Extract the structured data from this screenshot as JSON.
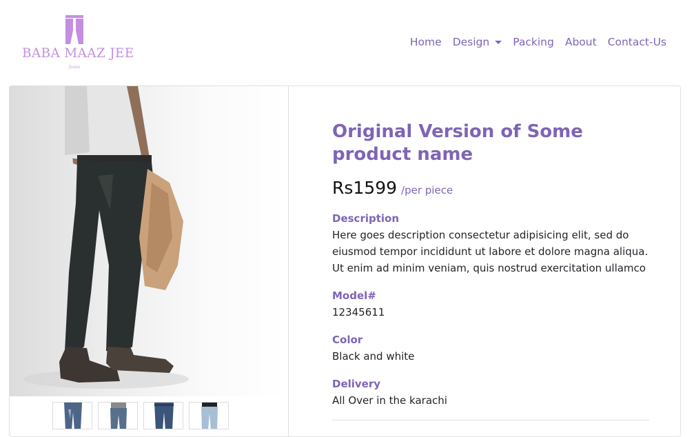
{
  "brand": {
    "name": "BABA MAAZ JEE",
    "tagline": "Jeans",
    "color": "#c48fe0"
  },
  "nav": {
    "items": [
      {
        "label": "Home"
      },
      {
        "label": "Design",
        "dropdown": true
      },
      {
        "label": "Packing"
      },
      {
        "label": "About"
      },
      {
        "label": "Contact-Us"
      }
    ]
  },
  "product": {
    "title": "Original Version of Some product name",
    "price": "Rs1599",
    "price_unit": "/per piece",
    "description_label": "Description",
    "description": "Here goes description consectetur adipisicing elit, sed do eiusmod tempor incididunt ut labore et dolore magna aliqua. Ut enim ad minim veniam, quis nostrud exercitation ullamco",
    "model_label": "Model#",
    "model": "12345611",
    "color_label": "Color",
    "color": "Black and white",
    "delivery_label": "Delivery",
    "delivery": "All Over in the karachi"
  },
  "gallery": {
    "main_image": "man-in-dark-jeans-photo",
    "thumbnails": [
      {
        "name": "jeans-thumbnail"
      },
      {
        "name": "jeans-thumbnail"
      },
      {
        "name": "jeans-thumbnail"
      },
      {
        "name": "jeans-thumbnail"
      }
    ]
  },
  "colors": {
    "accent": "#7e64b5",
    "border": "#dfdfdf",
    "text": "#212529"
  }
}
